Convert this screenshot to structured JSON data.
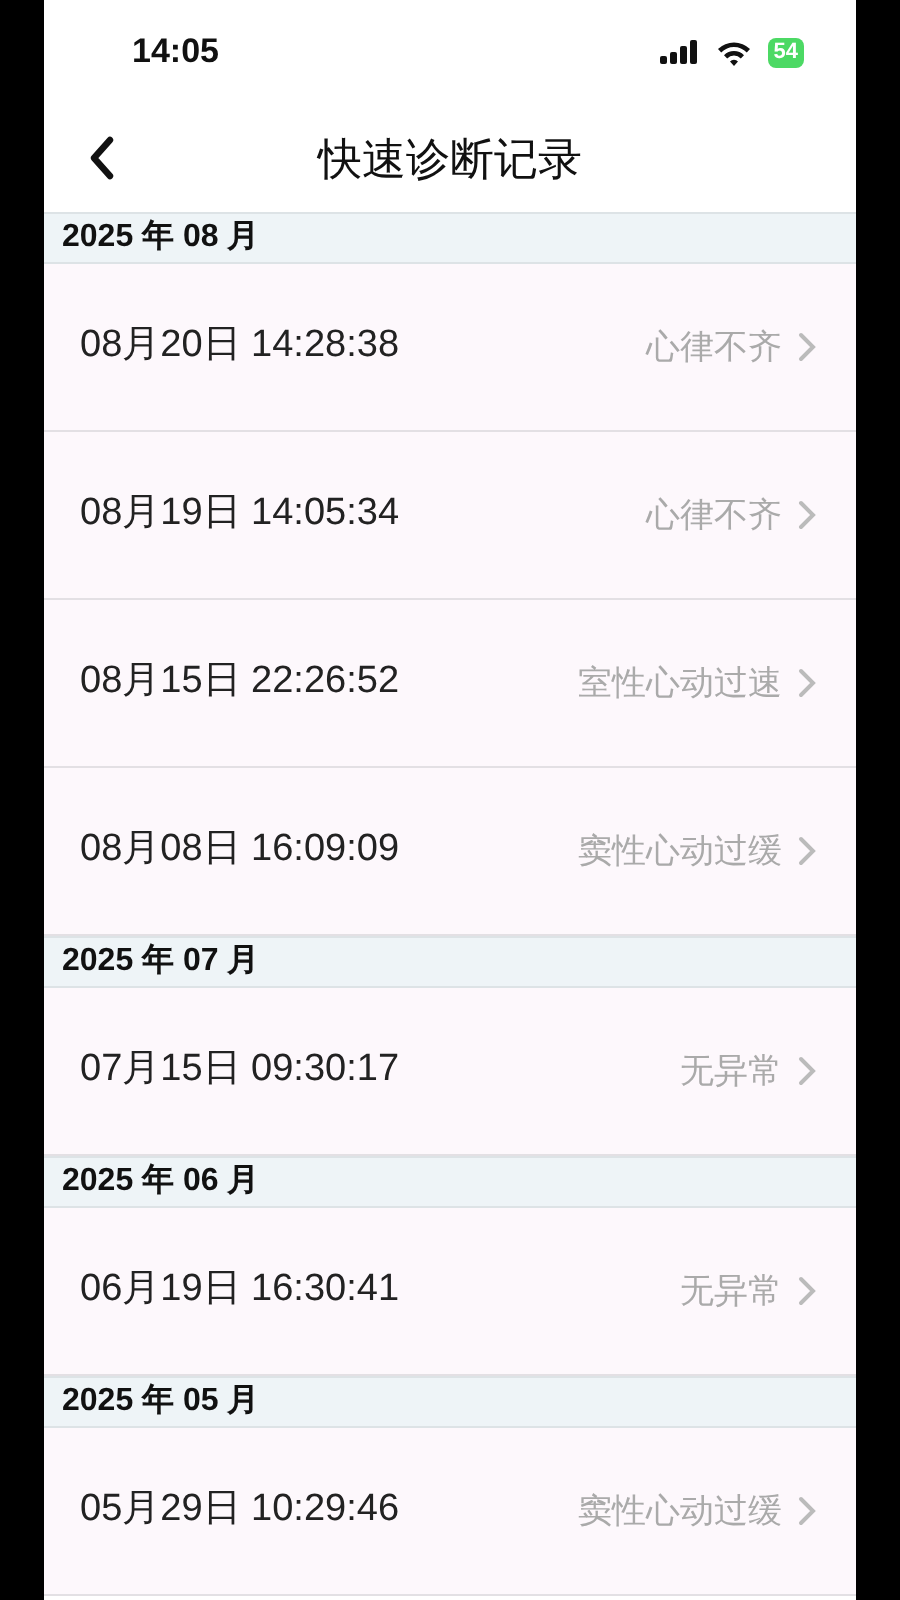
{
  "status_bar": {
    "time": "14:05",
    "battery": "54"
  },
  "nav_bar": {
    "title": "快速诊断记录"
  },
  "sections": [
    {
      "header": "2025 年 08 月",
      "records": [
        {
          "time": "08月20日 14:28:38",
          "diagnosis": "心律不齐"
        },
        {
          "time": "08月19日 14:05:34",
          "diagnosis": "心律不齐"
        },
        {
          "time": "08月15日 22:26:52",
          "diagnosis": "室性心动过速"
        },
        {
          "time": "08月08日 16:09:09",
          "diagnosis": "窦性心动过缓"
        }
      ]
    },
    {
      "header": "2025 年 07 月",
      "records": [
        {
          "time": "07月15日 09:30:17",
          "diagnosis": "无异常"
        }
      ]
    },
    {
      "header": "2025 年 06 月",
      "records": [
        {
          "time": "06月19日 16:30:41",
          "diagnosis": "无异常"
        }
      ]
    },
    {
      "header": "2025 年 05 月",
      "records": [
        {
          "time": "05月29日 10:29:46",
          "diagnosis": "窦性心动过缓"
        }
      ]
    }
  ]
}
